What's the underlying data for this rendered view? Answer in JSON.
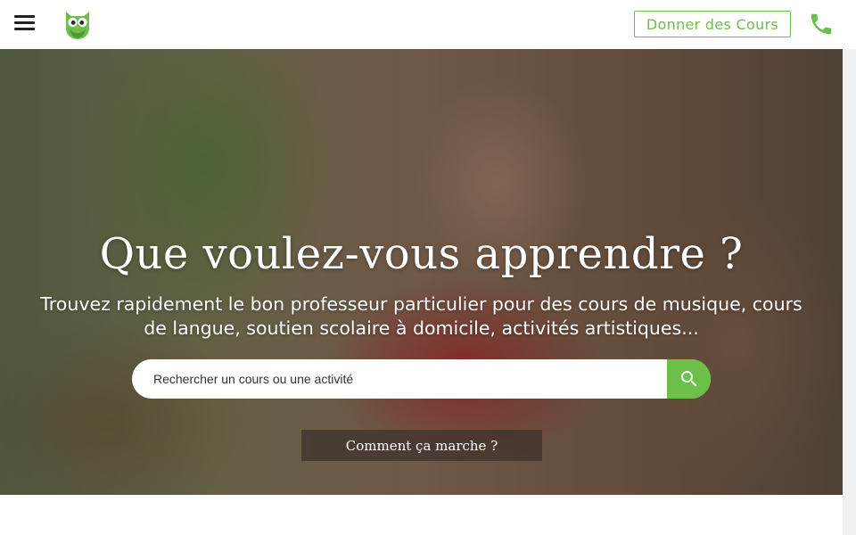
{
  "header": {
    "menu_icon": "hamburger-menu-icon",
    "logo_icon": "owl-logo-icon",
    "teach_label": "Donner des Cours",
    "phone_icon": "phone-icon"
  },
  "hero": {
    "title": "Que voulez-vous apprendre ?",
    "subtitle_line1": "Trouvez rapidement le bon professeur particulier pour des cours de musique, cours",
    "subtitle_line2": "de langue, soutien scolaire à domicile, activités artistiques...",
    "search": {
      "placeholder": "Rechercher un cours ou une activité",
      "button_icon": "search-icon"
    },
    "how_it_works_label": "Comment ça marche ?"
  },
  "colors": {
    "accent": "#6cc04a",
    "text_on_hero": "#ffffff"
  }
}
